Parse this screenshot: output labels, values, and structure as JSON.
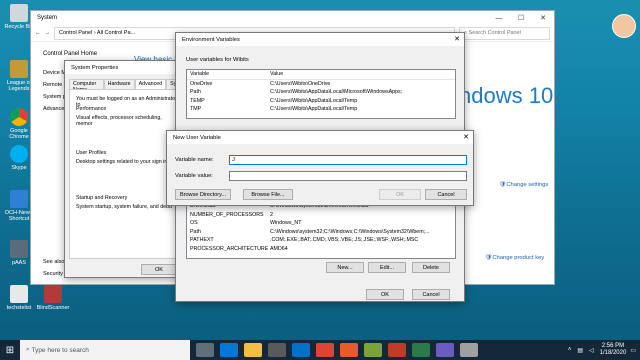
{
  "desktop_icons": [
    "Recycle Bin",
    "League of Legends",
    "Google Chrome",
    "Skype",
    "OCH-New - Shortcut",
    "pAAS",
    "techstelist",
    "BlindScanner"
  ],
  "system_window": {
    "title": "System",
    "address": "Control Panel › All Control Pa...",
    "search_placeholder": "Search Control Panel",
    "left_title": "Control Panel Home",
    "left_items": [
      "Device M",
      "Remote s",
      "System p",
      "Advance"
    ],
    "main_link": "View basic in",
    "windows_brand": "ndows 10",
    "change_settings": "Change settings",
    "change_product_key": "Change product key",
    "see_also": "See also",
    "security": "Security"
  },
  "system_properties": {
    "title": "System Properties",
    "tabs": [
      "Computer Name",
      "Hardware",
      "Advanced",
      "Sys"
    ],
    "admin_note": "You must be logged on as an Administrator to",
    "performance_label": "Performance",
    "performance_desc": "Visual effects, processor scheduling, memor",
    "user_profiles_label": "User Profiles",
    "user_profiles_desc": "Desktop settings related to your sign in",
    "startup_label": "Startup and Recovery",
    "startup_desc": "System startup, system failure, and debu",
    "ok": "OK"
  },
  "env_vars": {
    "title": "Environment Variables",
    "user_vars_label": "User variables for Wibits",
    "col_variable": "Variable",
    "col_value": "Value",
    "user_rows": [
      {
        "v": "OneDrive",
        "val": "C:\\Users\\Wibits\\OneDrive"
      },
      {
        "v": "Path",
        "val": "C:\\Users\\Wibits\\AppData\\Local\\Microsoft\\WindowsApps;"
      },
      {
        "v": "TEMP",
        "val": "C:\\Users\\Wibits\\AppData\\Local\\Temp"
      },
      {
        "v": "TMP",
        "val": "C:\\Users\\Wibits\\AppData\\Local\\Temp"
      }
    ],
    "sys_rows": [
      {
        "v": "DriverData",
        "val": "C:\\Windows\\System32\\Drivers\\DriverData"
      },
      {
        "v": "NUMBER_OF_PROCESSORS",
        "val": "2"
      },
      {
        "v": "OS",
        "val": "Windows_NT"
      },
      {
        "v": "Path",
        "val": "C:\\Windows\\system32;C:\\Windows;C:\\Windows\\System32\\Wbem;..."
      },
      {
        "v": "PATHEXT",
        "val": ".COM;.EXE;.BAT;.CMD;.VBS;.VBE;.JS;.JSE;.WSF;.WSH;.MSC"
      },
      {
        "v": "PROCESSOR_ARCHITECTURE",
        "val": "AMD64"
      }
    ],
    "new": "New...",
    "edit": "Edit...",
    "delete": "Delete",
    "ok": "OK",
    "cancel": "Cancel"
  },
  "new_user_var": {
    "title": "New User Variable",
    "name_label": "Variable name:",
    "name_value": "J",
    "value_label": "Variable value:",
    "value_value": "",
    "browse_dir": "Browse Directory...",
    "browse_file": "Browse File...",
    "ok": "OK",
    "cancel": "Cancel"
  },
  "taskbar": {
    "search_placeholder": "Type here to search",
    "time": "2:56 PM",
    "date": "1/18/2020"
  }
}
